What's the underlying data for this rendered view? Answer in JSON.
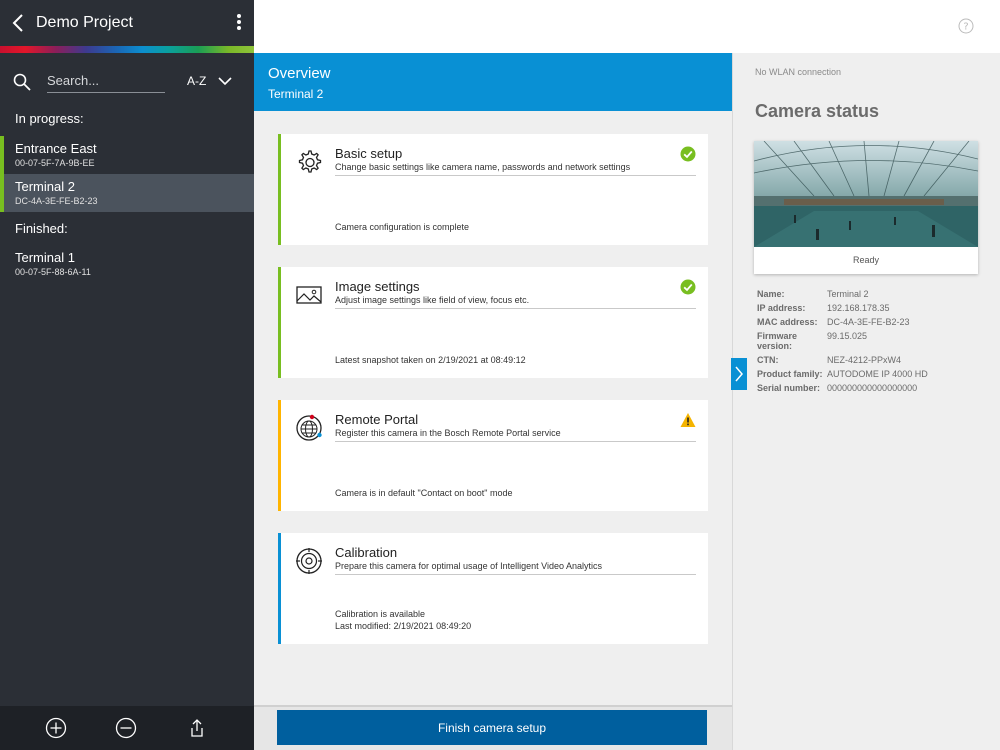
{
  "sidebar": {
    "title": "Demo Project",
    "search_placeholder": "Search...",
    "sort_label": "A-Z",
    "sections": {
      "in_progress": "In progress:",
      "finished": "Finished:"
    },
    "in_progress_items": [
      {
        "name": "Entrance East",
        "mac": "00-07-5F-7A-9B-EE"
      },
      {
        "name": "Terminal 2",
        "mac": "DC-4A-3E-FE-B2-23"
      }
    ],
    "finished_items": [
      {
        "name": "Terminal 1",
        "mac": "00-07-5F-88-6A-11"
      }
    ]
  },
  "overview": {
    "title": "Overview",
    "subtitle": "Terminal 2"
  },
  "cards": [
    {
      "title": "Basic setup",
      "desc": "Change basic settings like camera name, passwords and network settings",
      "footer": [
        "Camera configuration is complete"
      ],
      "state": "ok"
    },
    {
      "title": "Image settings",
      "desc": "Adjust image settings like field of view, focus etc.",
      "footer": [
        "Latest snapshot taken on 2/19/2021 at 08:49:12"
      ],
      "state": "ok"
    },
    {
      "title": "Remote Portal",
      "desc": "Register this camera in the Bosch Remote Portal service",
      "footer": [
        "Camera is in default \"Contact on boot\" mode"
      ],
      "state": "warning"
    },
    {
      "title": "Calibration",
      "desc": "Prepare this camera for optimal usage of Intelligent Video Analytics",
      "footer": [
        "Calibration is available",
        "Last modified: 2/19/2021  08:49:20"
      ],
      "state": "info"
    }
  ],
  "finish_button": "Finish camera setup",
  "camera_status": {
    "wlan": "No WLAN connection",
    "title": "Camera status",
    "snapshot_status": "Ready",
    "props": [
      {
        "k": "Name:",
        "v": "Terminal 2"
      },
      {
        "k": "IP address:",
        "v": "192.168.178.35"
      },
      {
        "k": "MAC address:",
        "v": "DC-4A-3E-FE-B2-23"
      },
      {
        "k": "Firmware version:",
        "v": "99.15.025"
      },
      {
        "k": "CTN:",
        "v": "NEZ-4212-PPxW4"
      },
      {
        "k": "Product family:",
        "v": "AUTODOME IP 4000 HD"
      },
      {
        "k": "Serial number:",
        "v": "000000000000000000"
      }
    ]
  },
  "colors": {
    "accent": "#0990d4",
    "ok": "#78be20",
    "warning": "#ffcf00",
    "info": "#0990d4",
    "primary_button": "#005f9e",
    "sidebar_bg": "#2b2f36"
  }
}
